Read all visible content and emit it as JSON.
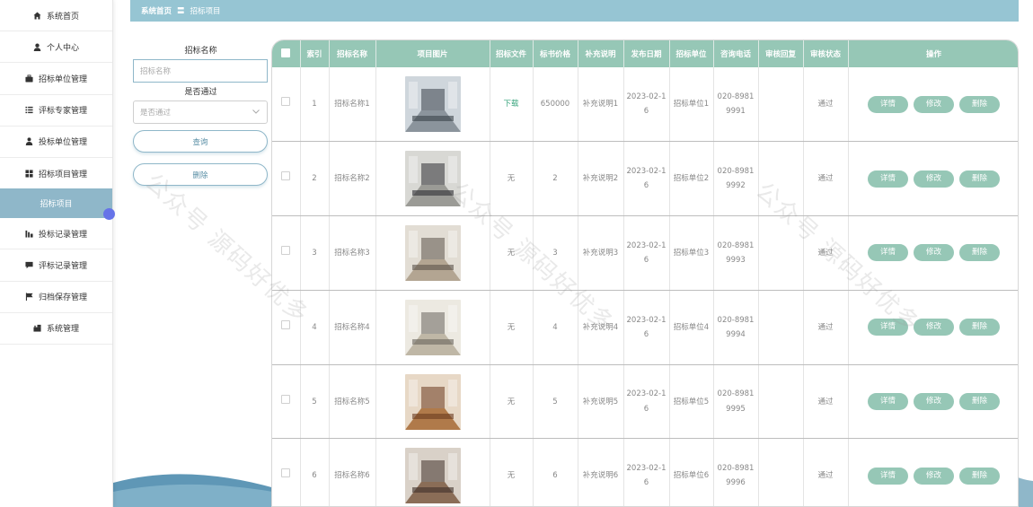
{
  "sidebar": {
    "items": [
      {
        "label": "系统首页",
        "icon": "home-icon",
        "active": false
      },
      {
        "label": "个人中心",
        "icon": "user-icon",
        "active": false
      },
      {
        "label": "招标单位管理",
        "icon": "briefcase-icon",
        "active": false
      },
      {
        "label": "评标专家管理",
        "icon": "list-icon",
        "active": false
      },
      {
        "label": "投标单位管理",
        "icon": "user-tie-icon",
        "active": false
      },
      {
        "label": "招标项目管理",
        "icon": "grid-icon",
        "active": false
      },
      {
        "label": "招标项目",
        "icon": "",
        "active": true
      },
      {
        "label": "投标记录管理",
        "icon": "chart-icon",
        "active": false
      },
      {
        "label": "评标记录管理",
        "icon": "comment-icon",
        "active": false
      },
      {
        "label": "归档保存管理",
        "icon": "flag-icon",
        "active": false
      },
      {
        "label": "系统管理",
        "icon": "settings-icon",
        "active": false
      }
    ]
  },
  "breadcrumb": {
    "home": "系统首页",
    "separator": "〓",
    "current": "招标项目"
  },
  "search": {
    "name_label": "招标名称",
    "name_placeholder": "招标名称",
    "pass_label": "是否通过",
    "pass_placeholder": "是否通过",
    "query_button": "查询",
    "delete_button": "删除"
  },
  "table": {
    "headers": [
      "索引",
      "招标名称",
      "项目图片",
      "招标文件",
      "标书价格",
      "补充说明",
      "发布日期",
      "招标单位",
      "咨询电话",
      "审核回复",
      "审核状态",
      "操作"
    ],
    "actions": {
      "detail": "详情",
      "edit": "修改",
      "delete": "删除"
    },
    "rows": [
      {
        "index": "1",
        "name": "招标名称1",
        "image": "office-image-1",
        "file": "下载",
        "price": "650000",
        "note": "补充说明1",
        "date": "2023-02-16",
        "unit": "招标单位1",
        "phone": "020-89819991",
        "reply": "",
        "status": "通过"
      },
      {
        "index": "2",
        "name": "招标名称2",
        "image": "office-image-2",
        "file": "无",
        "price": "2",
        "note": "补充说明2",
        "date": "2023-02-16",
        "unit": "招标单位2",
        "phone": "020-89819992",
        "reply": "",
        "status": "通过"
      },
      {
        "index": "3",
        "name": "招标名称3",
        "image": "office-image-3",
        "file": "无",
        "price": "3",
        "note": "补充说明3",
        "date": "2023-02-16",
        "unit": "招标单位3",
        "phone": "020-89819993",
        "reply": "",
        "status": "通过"
      },
      {
        "index": "4",
        "name": "招标名称4",
        "image": "office-image-4",
        "file": "无",
        "price": "4",
        "note": "补充说明4",
        "date": "2023-02-16",
        "unit": "招标单位4",
        "phone": "020-89819994",
        "reply": "",
        "status": "通过"
      },
      {
        "index": "5",
        "name": "招标名称5",
        "image": "office-image-5",
        "file": "无",
        "price": "5",
        "note": "补充说明5",
        "date": "2023-02-16",
        "unit": "招标单位5",
        "phone": "020-89819995",
        "reply": "",
        "status": "通过"
      },
      {
        "index": "6",
        "name": "招标名称6",
        "image": "office-image-6",
        "file": "无",
        "price": "6",
        "note": "补充说明6",
        "date": "2023-02-16",
        "unit": "招标单位6",
        "phone": "020-89819996",
        "reply": "",
        "status": "通过"
      }
    ]
  },
  "watermark": "公众号 源码好优多",
  "colors": {
    "accent": "#96c7b6",
    "topbar": "#96c5d3",
    "active_nav": "#8fb7c9",
    "link": "#3aa57e"
  }
}
